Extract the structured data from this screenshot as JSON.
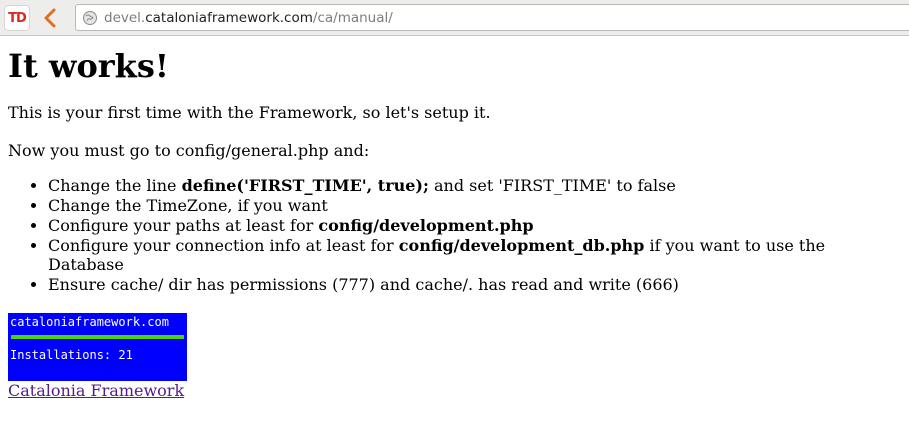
{
  "browser": {
    "url_prefix": "devel.",
    "url_domain": "cataloniaframework.com",
    "url_path": "/ca/manual/",
    "extension_label": "TD"
  },
  "page": {
    "heading": "It works!",
    "intro": "This is your first time with the Framework, so let's setup it.",
    "instruction": "Now you must go to config/general.php and:",
    "steps": [
      {
        "before": "Change the line ",
        "bold": "define('FIRST_TIME', true);",
        "after": " and set 'FIRST_TIME' to false"
      },
      {
        "before": "Change the TimeZone, if you want",
        "bold": "",
        "after": ""
      },
      {
        "before": "Configure your paths at least for ",
        "bold": "config/development.php",
        "after": ""
      },
      {
        "before": "Configure your connection info at least for ",
        "bold": "config/development_db.php",
        "after": " if you want to use the Database"
      },
      {
        "before": "Ensure cache/ dir has permissions (777) and cache/. has read and write (666)",
        "bold": "",
        "after": ""
      }
    ],
    "badge": {
      "domain": "cataloniaframework.com",
      "installations": "Installations: 21",
      "bg_color": "#0000ff",
      "bar_color": "#48d60d"
    },
    "link_text": "Catalonia Framework"
  }
}
